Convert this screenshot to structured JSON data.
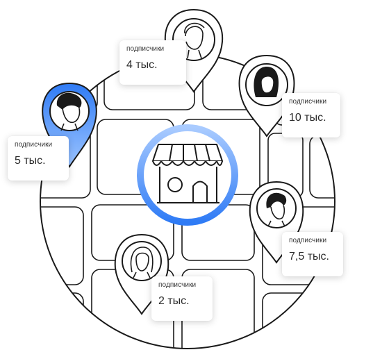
{
  "colors": {
    "accent": "#2F7BF5",
    "accent_light": "#8BBBFF",
    "line": "#1A1A1A",
    "background": "#FFFFFF"
  },
  "center": {
    "icon": "storefront-icon"
  },
  "pins": [
    {
      "name": "pin-top",
      "label": "подписчики",
      "value": "4 тыс.",
      "highlighted": false
    },
    {
      "name": "pin-top-right",
      "label": "подписчики",
      "value": "10 тыс.",
      "highlighted": false
    },
    {
      "name": "pin-left",
      "label": "подписчики",
      "value": "5 тыс.",
      "highlighted": true
    },
    {
      "name": "pin-right",
      "label": "подписчики",
      "value": "7,5 тыс.",
      "highlighted": false
    },
    {
      "name": "pin-bottom",
      "label": "подписчики",
      "value": "2 тыс.",
      "highlighted": false
    }
  ]
}
